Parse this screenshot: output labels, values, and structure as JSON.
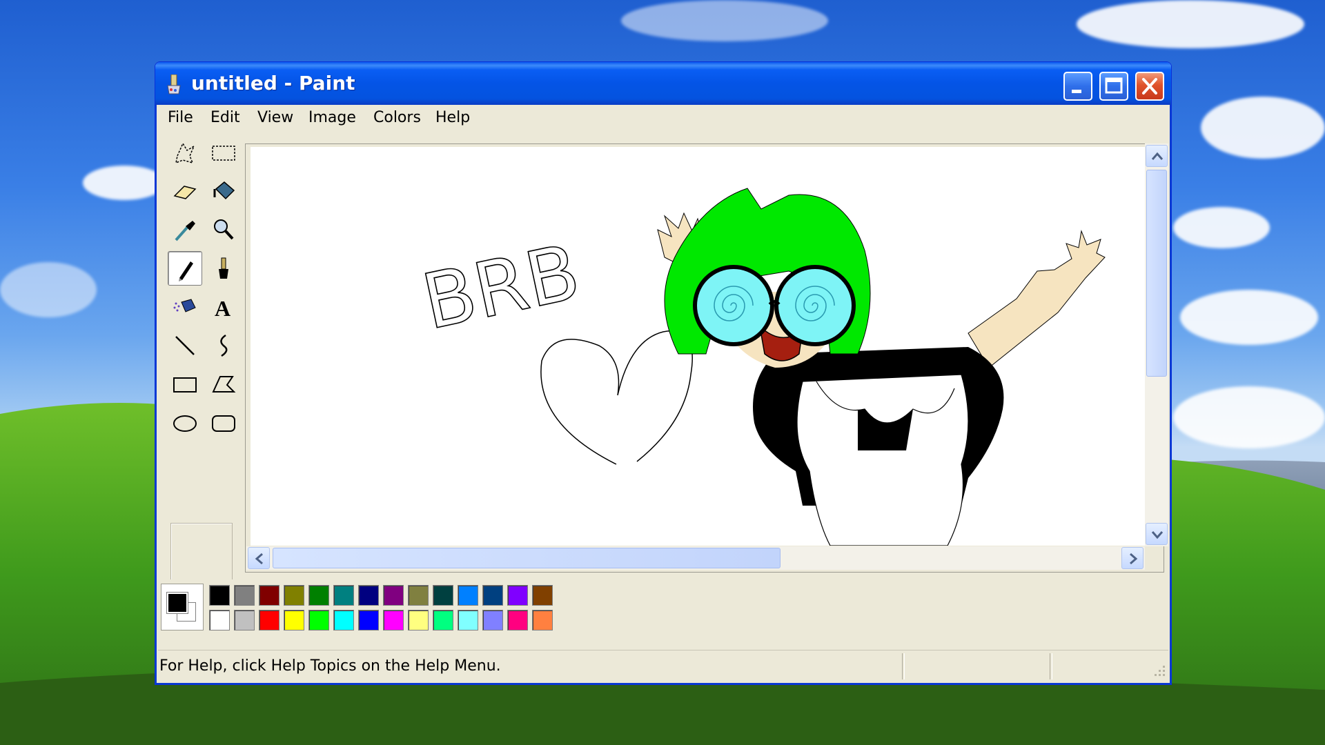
{
  "window": {
    "title": "untitled - Paint",
    "app_icon": "paint-brush-icon"
  },
  "title_buttons": {
    "minimize_icon": "minimize-icon",
    "maximize_icon": "maximize-icon",
    "close_icon": "close-icon"
  },
  "menu": {
    "items": [
      "File",
      "Edit",
      "View",
      "Image",
      "Colors",
      "Help"
    ]
  },
  "toolbox": {
    "tools": [
      {
        "icon": "free-form-select-icon"
      },
      {
        "icon": "rectangle-select-icon"
      },
      {
        "icon": "eraser-icon"
      },
      {
        "icon": "fill-bucket-icon"
      },
      {
        "icon": "pick-color-icon"
      },
      {
        "icon": "magnifier-icon"
      },
      {
        "icon": "pencil-icon",
        "active": true
      },
      {
        "icon": "brush-icon"
      },
      {
        "icon": "airbrush-icon"
      },
      {
        "icon": "text-tool-icon",
        "label": "A"
      },
      {
        "icon": "line-icon"
      },
      {
        "icon": "curve-icon"
      },
      {
        "icon": "rectangle-icon"
      },
      {
        "icon": "polygon-icon"
      },
      {
        "icon": "ellipse-icon"
      },
      {
        "icon": "rounded-rectangle-icon"
      }
    ]
  },
  "drawing": {
    "text": "BRB"
  },
  "palette": {
    "foreground": "#000000",
    "background": "#ffffff",
    "row1": [
      "#000000",
      "#808080",
      "#800000",
      "#808000",
      "#008000",
      "#008080",
      "#000080",
      "#800080",
      "#808040",
      "#004040",
      "#0080ff",
      "#004080",
      "#8000ff",
      "#804000"
    ],
    "row2": [
      "#ffffff",
      "#c0c0c0",
      "#ff0000",
      "#ffff00",
      "#00ff00",
      "#00ffff",
      "#0000ff",
      "#ff00ff",
      "#ffff80",
      "#00ff80",
      "#80ffff",
      "#8080ff",
      "#ff0080",
      "#ff8040"
    ]
  },
  "statusbar": {
    "help_text": "For Help, click Help Topics on the Help Menu."
  }
}
